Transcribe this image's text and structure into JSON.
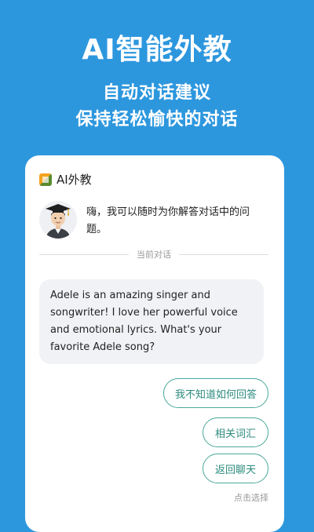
{
  "hero": {
    "title": "AI智能外教",
    "subtitle_line1": "自动对话建议",
    "subtitle_line2": "保持轻松愉快的对话"
  },
  "card": {
    "icon": "app-logo-icon",
    "title": "AI外教",
    "bot_message": "嗨，我可以随时为你解答对话中的问题。",
    "divider_label": "当前对话",
    "ai_bubble": "Adele is an amazing singer and songwriter! I love her powerful voice and emotional lyrics. What's your favorite Adele song?",
    "options": [
      "我不知道如何回答",
      "相关词汇",
      "返回聊天"
    ],
    "hint": "点击选择"
  },
  "colors": {
    "background": "#2d97de",
    "accent": "#4aa89a",
    "bubble": "#f0f2f5"
  }
}
